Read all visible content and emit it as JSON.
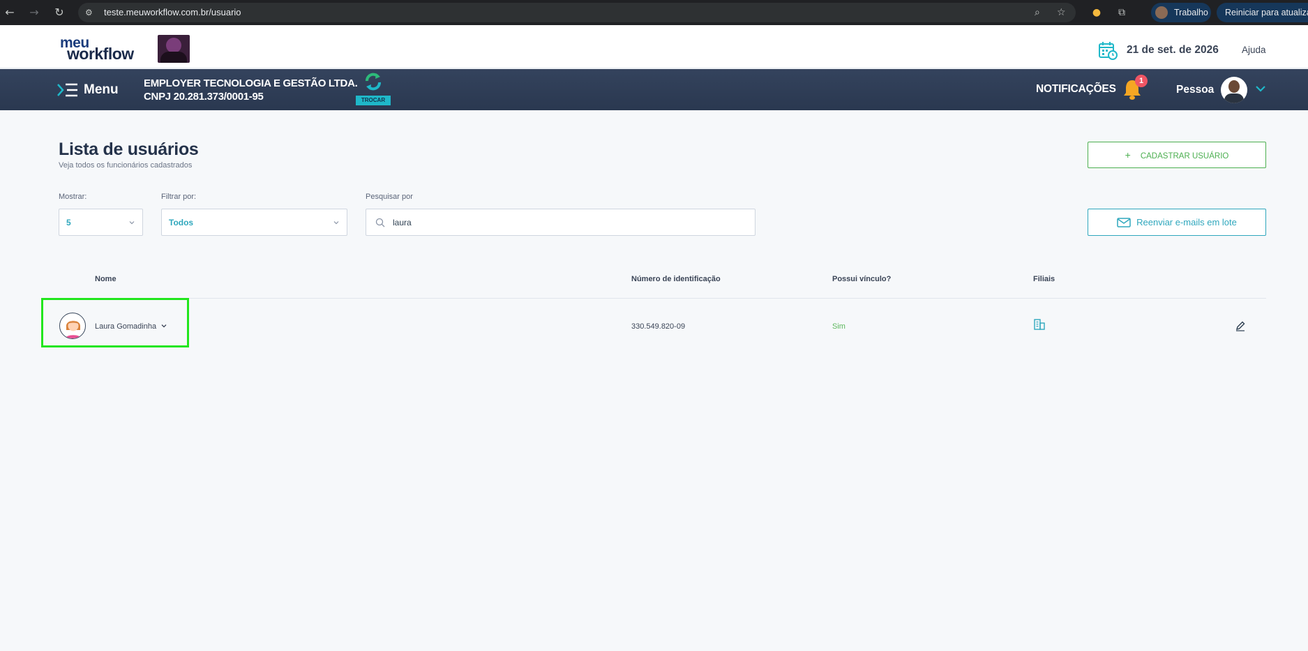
{
  "browser": {
    "url": "teste.meuworkflow.com.br/usuario",
    "profile_label": "Trabalho",
    "update_label": "Reiniciar para atualizar"
  },
  "header": {
    "logo_line1": "meu",
    "logo_line2": "workflow",
    "date": "21 de set. de 2026",
    "help_label": "Ajuda"
  },
  "navbar": {
    "menu_label": "Menu",
    "company_name": "EMPLOYER TECNOLOGIA E GESTÃO LTDA.",
    "company_cnpj": "CNPJ 20.281.373/0001-95",
    "swap_label": "TROCAR",
    "notifications_label": "NOTIFICAÇÕES",
    "notifications_count": "1",
    "user_name": "Pessoa"
  },
  "page": {
    "title": "Lista de usuários",
    "subtitle": "Veja todos os funcionários cadastrados",
    "add_user_label": "CADASTRAR USUÁRIO",
    "resend_label": "Reenviar e-mails em lote"
  },
  "filters": {
    "show_label": "Mostrar:",
    "show_value": "5",
    "filter_label": "Filtrar por:",
    "filter_value": "Todos",
    "search_label": "Pesquisar por",
    "search_value": "laura"
  },
  "table": {
    "headers": [
      "Nome",
      "Número de identificação",
      "Possui vínculo?",
      "Filiais"
    ],
    "rows": [
      {
        "name": "Laura Gomadinha",
        "id": "330.549.820-09",
        "has_link": "Sim"
      }
    ]
  },
  "colors": {
    "navbar": "#2e3c55",
    "accent_cyan": "#2fa7bd",
    "accent_green": "#4caf50",
    "highlight": "#22e61d"
  }
}
